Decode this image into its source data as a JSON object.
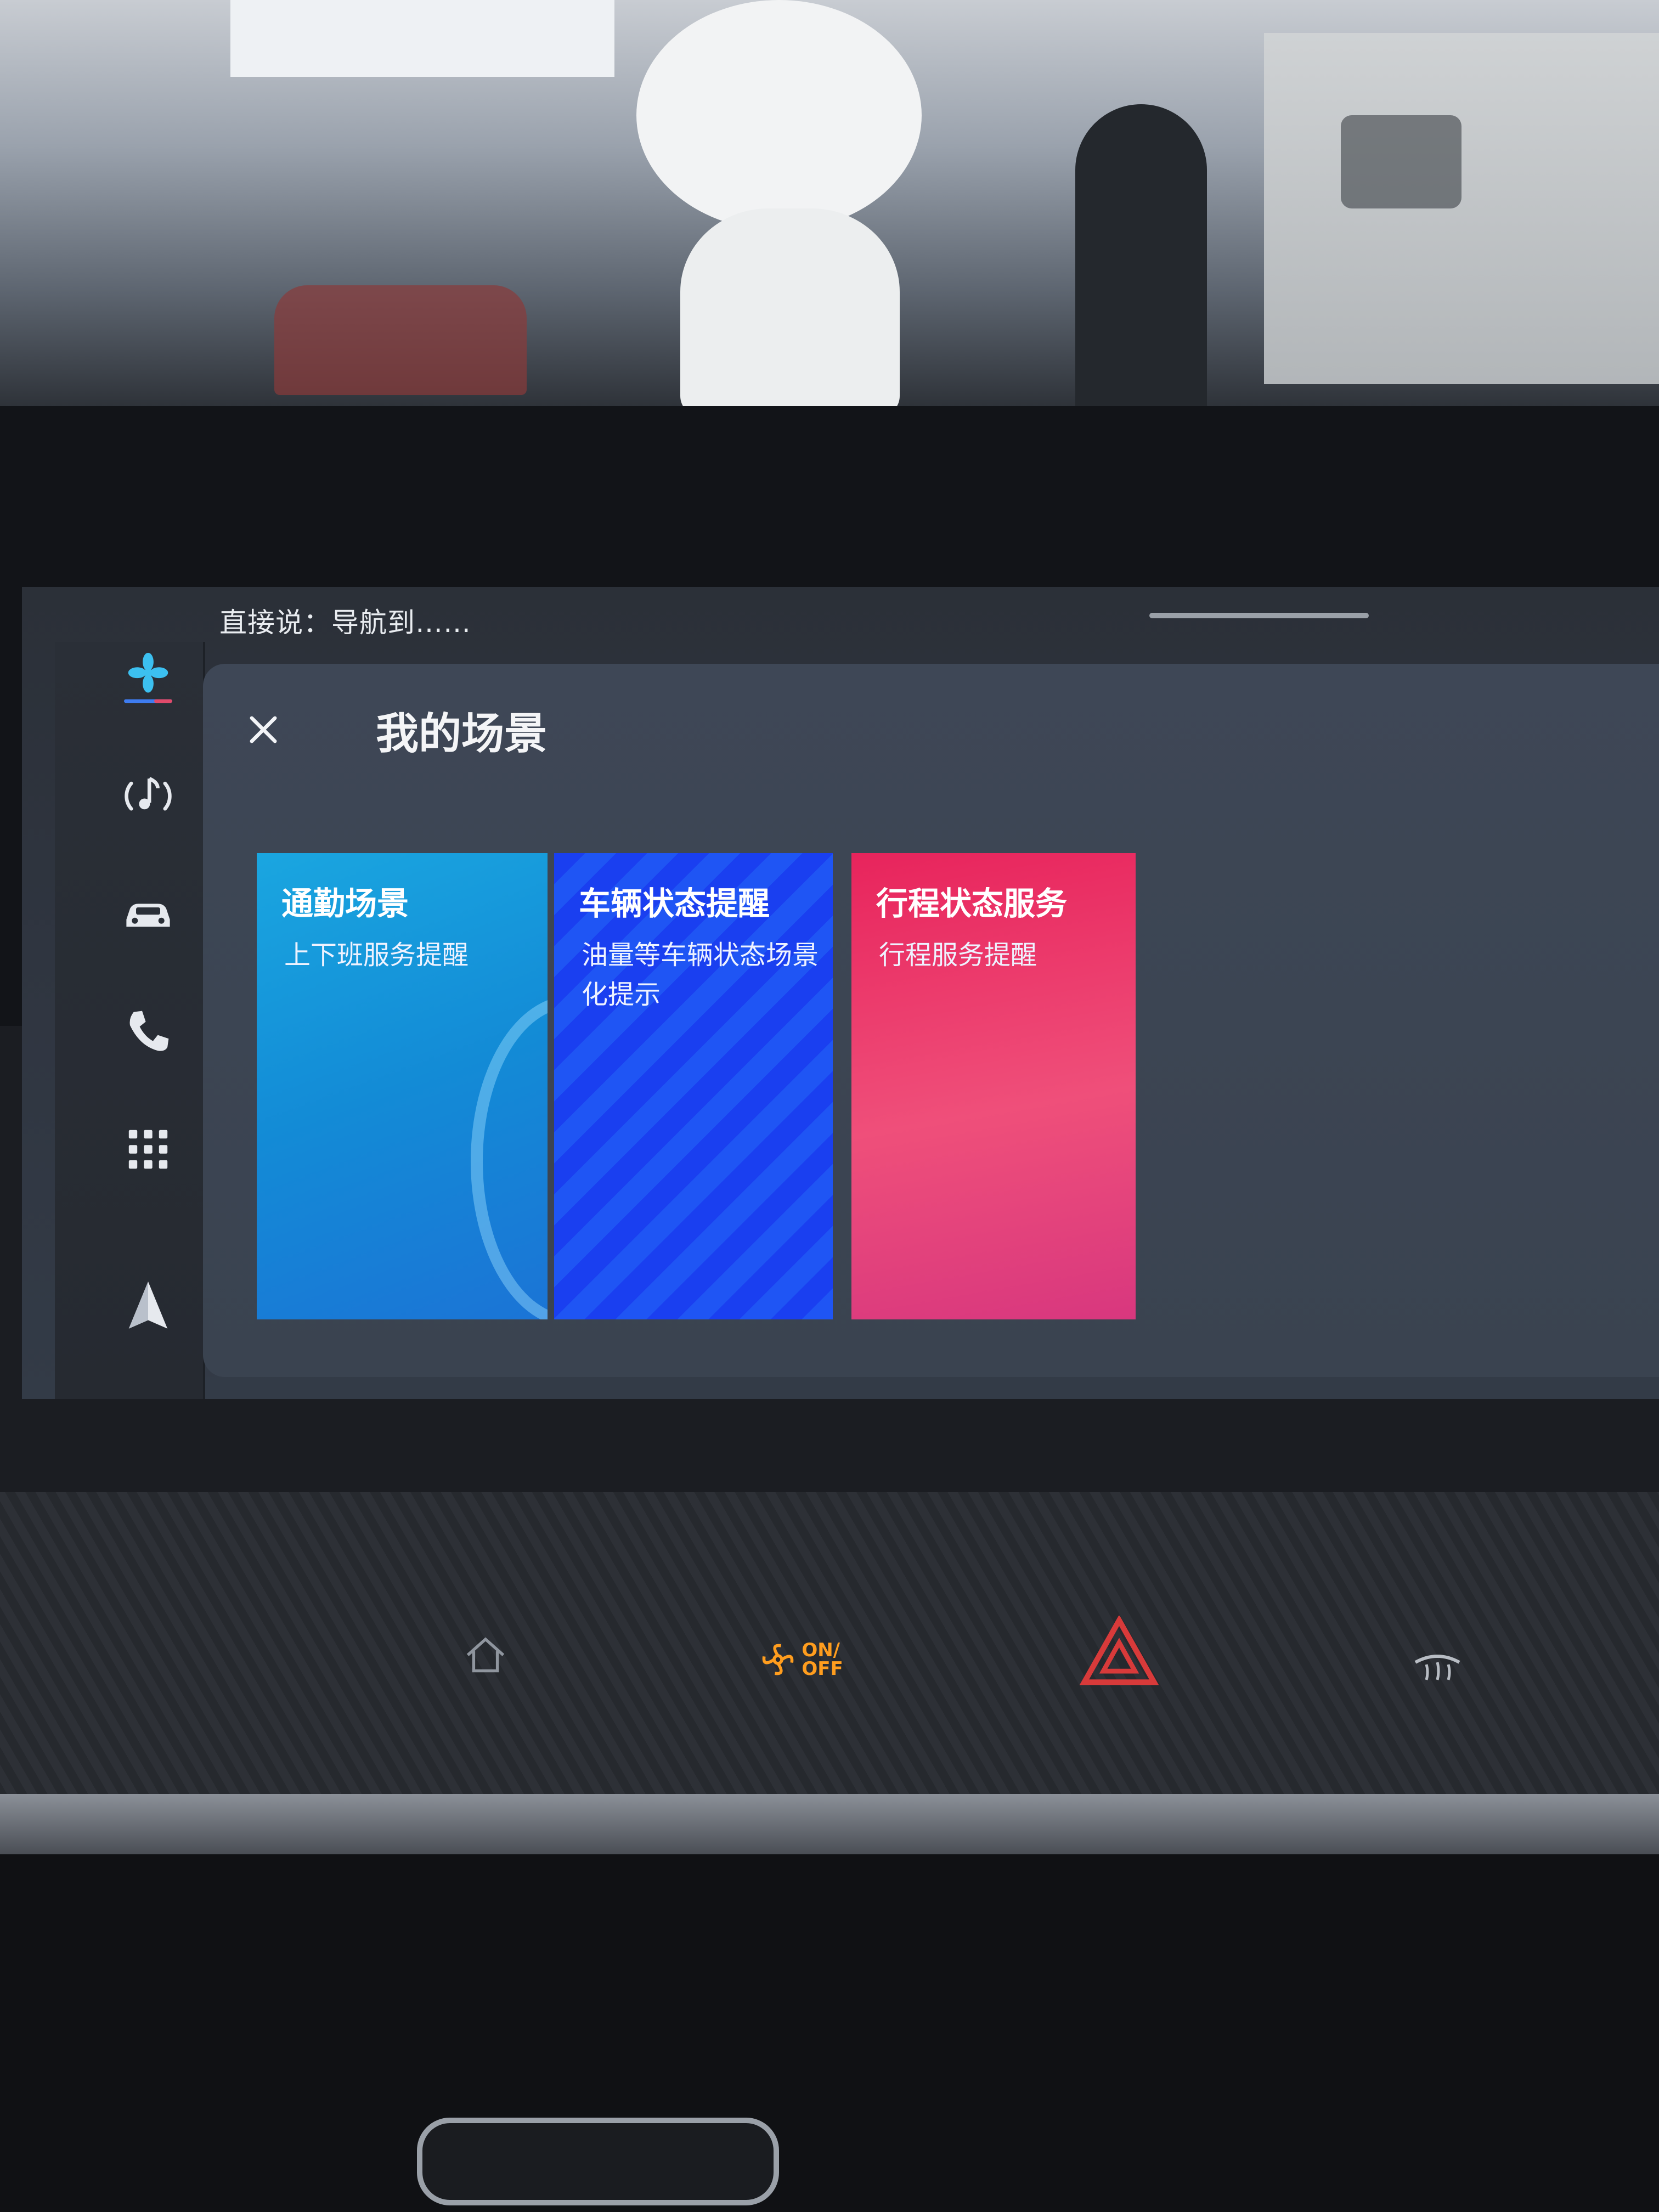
{
  "voice_hint": "直接说：导航到……",
  "panel": {
    "title": "我的场景",
    "close_icon": "close-icon"
  },
  "sidebar": {
    "items": [
      {
        "name": "climate",
        "icon": "fan-icon"
      },
      {
        "name": "media",
        "icon": "music-icon"
      },
      {
        "name": "vehicle",
        "icon": "car-icon"
      },
      {
        "name": "phone",
        "icon": "phone-icon"
      },
      {
        "name": "apps",
        "icon": "grid-icon"
      },
      {
        "name": "navigation",
        "icon": "navigation-arrow-icon"
      }
    ]
  },
  "cards": [
    {
      "title": "通勤场景",
      "subtitle": "上下班服务提醒",
      "color": "#1a9ee0"
    },
    {
      "title": "车辆状态提醒",
      "subtitle": "油量等车辆状态场景化提示",
      "color": "#1d4bf2"
    },
    {
      "title": "行程状态服务",
      "subtitle": "行程服务提醒",
      "color": "#e8316a"
    }
  ],
  "hardware": {
    "onoff_label_1": "ON/",
    "onoff_label_2": "OFF"
  },
  "colors": {
    "accent_orange": "#ff9d1e",
    "hazard_red": "#d83a3a"
  }
}
